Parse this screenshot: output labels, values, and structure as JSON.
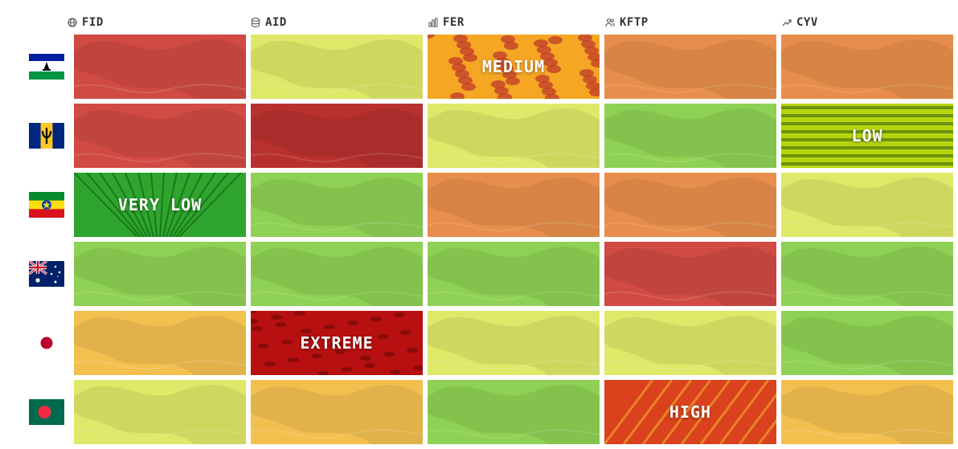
{
  "chart_data": {
    "type": "heatmap",
    "columns": [
      {
        "label": "FID",
        "icon": "globe-icon"
      },
      {
        "label": "AID",
        "icon": "database-icon"
      },
      {
        "label": "FER",
        "icon": "bar-chart-icon"
      },
      {
        "label": "KFTP",
        "icon": "users-icon"
      },
      {
        "label": "CYV",
        "icon": "trend-up-icon"
      }
    ],
    "rows": [
      {
        "flag": "lesotho-flag-icon",
        "cells": [
          "high",
          "low",
          "medium",
          "elevated",
          "elevated"
        ]
      },
      {
        "flag": "barbados-flag-icon",
        "cells": [
          "high",
          "very-high",
          "low",
          "very-low",
          "low"
        ]
      },
      {
        "flag": "ethiopia-flag-icon",
        "cells": [
          "very-low",
          "very-low",
          "elevated",
          "elevated",
          "low"
        ]
      },
      {
        "flag": "australia-flag-icon",
        "cells": [
          "very-low",
          "very-low",
          "very-low",
          "high",
          "very-low"
        ]
      },
      {
        "flag": "japan-flag-icon",
        "cells": [
          "moderate",
          "extreme",
          "low",
          "low",
          "very-low"
        ]
      },
      {
        "flag": "bangladesh-flag-icon",
        "cells": [
          "low",
          "moderate",
          "very-low",
          "high",
          "moderate"
        ]
      }
    ],
    "labels": [
      {
        "row": 0,
        "col": 2,
        "text": "MEDIUM"
      },
      {
        "row": 1,
        "col": 4,
        "text": "LOW"
      },
      {
        "row": 2,
        "col": 0,
        "text": "VERY LOW"
      },
      {
        "row": 4,
        "col": 1,
        "text": "EXTREME"
      },
      {
        "row": 5,
        "col": 3,
        "text": "HIGH"
      }
    ],
    "colors": {
      "very-low": "#8fd154",
      "low": "#dfe868",
      "moderate": "#f3c050",
      "elevated": "#e88e4c",
      "medium": "#f28a1a",
      "high": "#d14a44",
      "very-high": "#b8312f",
      "extreme": "#c21212"
    },
    "photo_tiles": [
      {
        "row": 0,
        "col": 2,
        "type": "grain-icon"
      },
      {
        "row": 1,
        "col": 4,
        "type": "crop-rows-icon"
      },
      {
        "row": 2,
        "col": 0,
        "type": "greenhouse-icon"
      },
      {
        "row": 4,
        "col": 1,
        "type": "field-icon"
      },
      {
        "row": 5,
        "col": 3,
        "type": "irrigation-icon"
      }
    ]
  }
}
